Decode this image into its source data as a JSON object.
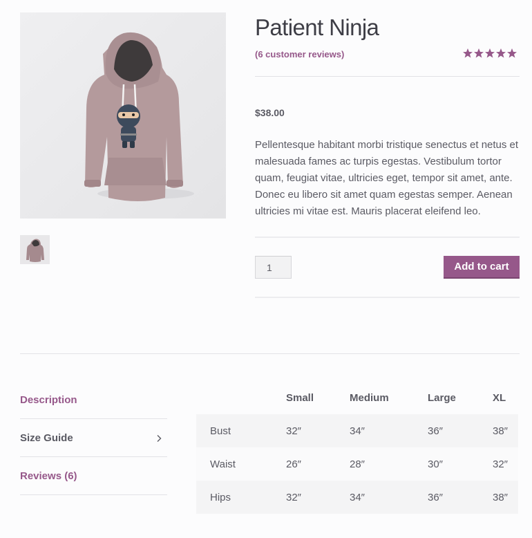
{
  "product": {
    "title": "Patient Ninja",
    "reviews_link": "(6 customer reviews)",
    "rating": 5,
    "price": "$38.00",
    "description": "Pellentesque habitant morbi tristique senectus et netus et malesuada fames ac turpis egestas. Vestibulum tortor quam, feugiat vitae, ultricies eget, tempor sit amet, ante. Donec eu libero sit amet quam egestas semper. Aenean ultricies mi vitae est. Mauris placerat eleifend leo.",
    "quantity": "1",
    "add_to_cart_label": "Add to cart"
  },
  "tabs": [
    {
      "label": "Description"
    },
    {
      "label": "Size Guide",
      "icon": "chevron-right-icon"
    },
    {
      "label": "Reviews (6)"
    }
  ],
  "size_guide": {
    "headers": [
      "",
      "Small",
      "Medium",
      "Large",
      "XL"
    ],
    "rows": [
      [
        "Bust",
        "32″",
        "34″",
        "36″",
        "38″"
      ],
      [
        "Waist",
        "26″",
        "28″",
        "30″",
        "32″"
      ],
      [
        "Hips",
        "32″",
        "34″",
        "36″",
        "38″"
      ]
    ]
  },
  "colors": {
    "accent": "#96588a",
    "text": "#5a5a63",
    "hoodie": "#b49a9c"
  }
}
